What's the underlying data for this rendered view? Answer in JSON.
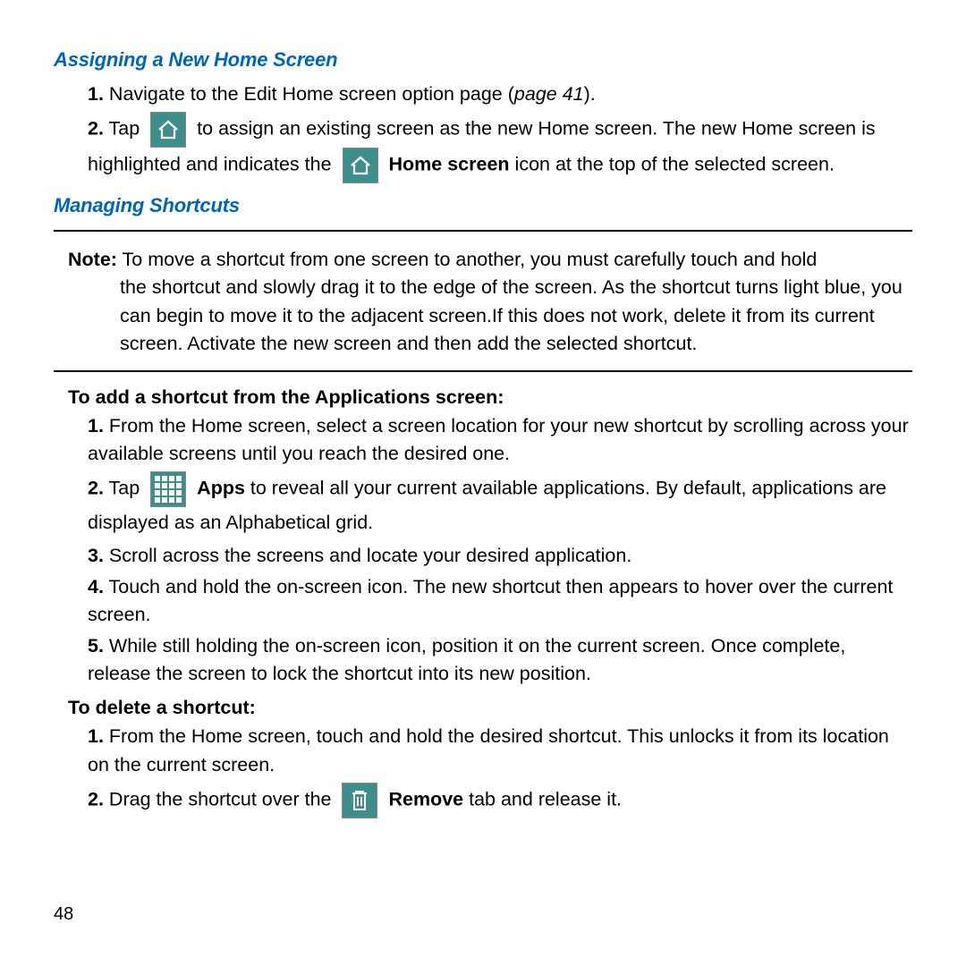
{
  "heading1": "Assigning a New Home Screen",
  "assign": {
    "s1": {
      "n": "1.",
      "t": "Navigate to the Edit Home screen option page (",
      "ref": "page 41",
      "after": ")."
    },
    "s2": {
      "n": "2.",
      "a": "Tap",
      "b": "to assign an existing screen as the new Home screen. The new Home screen is highlighted and indicates the",
      "label": "Home screen",
      "c": "icon at the top of the selected screen."
    }
  },
  "heading2": "Managing Shortcuts",
  "note": {
    "label": "Note:",
    "first": "To move a shortcut from one screen to another, you must carefully touch and hold",
    "rest": "the shortcut and slowly drag it to the edge of the screen. As the shortcut turns light blue, you can begin to move it to the adjacent screen.If this does not work, delete it from its current screen. Activate the new screen and then add the selected shortcut."
  },
  "sub1": "To add a shortcut from the Applications screen:",
  "add": {
    "s1": {
      "n": "1.",
      "t": "From the Home screen, select a screen location for your new shortcut by scrolling across your available screens until you reach the desired one."
    },
    "s2": {
      "n": "2.",
      "a": "Tap",
      "label": "Apps",
      "b": "to reveal all your current available applications. By default, applications are displayed as an Alphabetical grid."
    },
    "s3": {
      "n": "3.",
      "t": "Scroll across the screens and locate your desired application."
    },
    "s4": {
      "n": "4.",
      "t": "Touch and hold the on-screen icon. The new shortcut then appears to hover over the current screen."
    },
    "s5": {
      "n": "5.",
      "t": "While still holding the on-screen icon, position it on the current screen. Once complete, release the screen to lock the shortcut into its new position."
    }
  },
  "sub2": "To delete a shortcut:",
  "del": {
    "s1": {
      "n": "1.",
      "t": "From the Home screen, touch and hold the desired shortcut. This unlocks it from its location on the current screen."
    },
    "s2": {
      "n": "2.",
      "a": "Drag the shortcut over the",
      "label": "Remove",
      "b": "tab and release it."
    }
  },
  "page": "48"
}
